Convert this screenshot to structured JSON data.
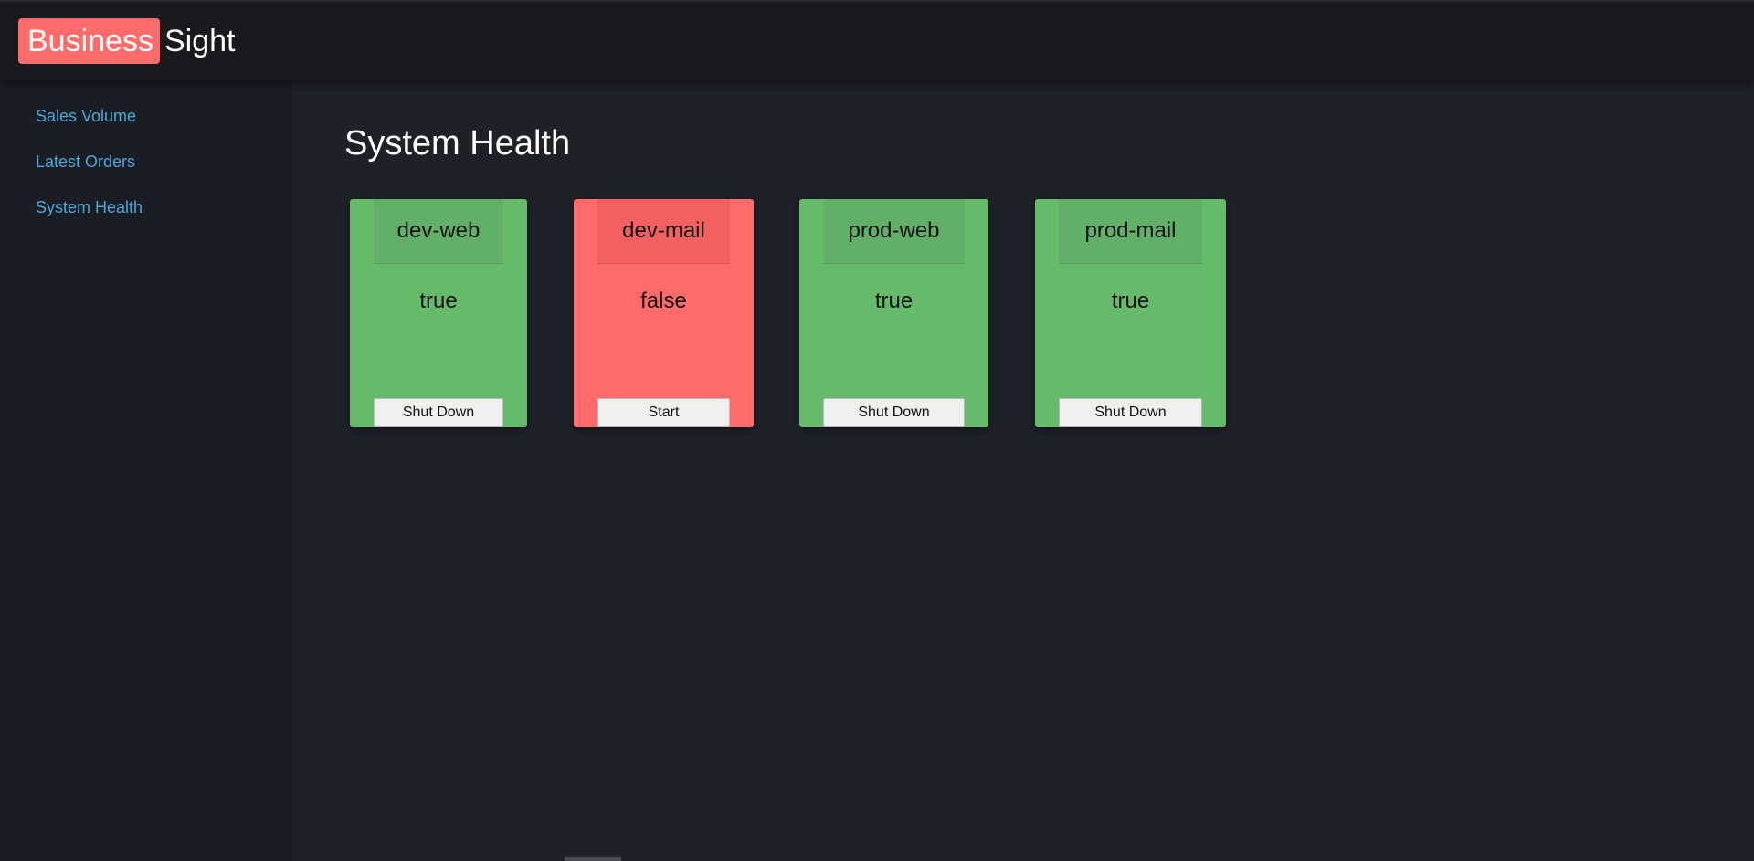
{
  "brand": {
    "highlight": "Business",
    "rest": "Sight",
    "highlight_color": "#ff6b6b"
  },
  "sidebar": {
    "items": [
      {
        "label": "Sales Volume"
      },
      {
        "label": "Latest Orders"
      },
      {
        "label": "System Health"
      }
    ]
  },
  "main": {
    "title": "System Health",
    "servers": [
      {
        "name": "dev-web",
        "status": "true",
        "action": "Shut Down",
        "color": "#66bb6a"
      },
      {
        "name": "dev-mail",
        "status": "false",
        "action": "Start",
        "color": "#ff6b6b"
      },
      {
        "name": "prod-web",
        "status": "true",
        "action": "Shut Down",
        "color": "#66bb6a"
      },
      {
        "name": "prod-mail",
        "status": "true",
        "action": "Shut Down",
        "color": "#66bb6a"
      }
    ]
  }
}
